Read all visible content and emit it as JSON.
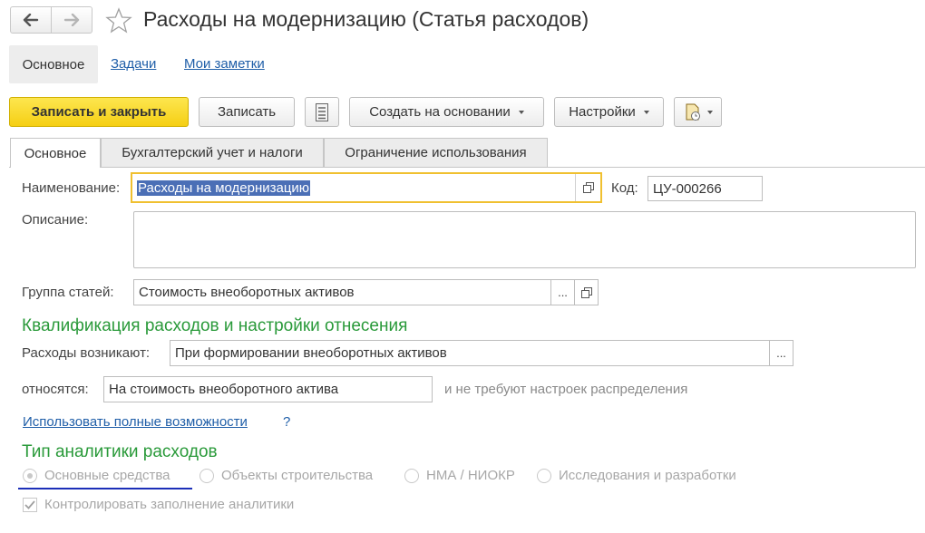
{
  "window": {
    "title": "Расходы на модернизацию (Статья расходов)"
  },
  "sections": {
    "active": "Основное",
    "links": [
      "Задачи",
      "Мои заметки"
    ]
  },
  "toolbar": {
    "save_close": "Записать и закрыть",
    "save": "Записать",
    "create_based_on": "Создать на основании",
    "settings": "Настройки"
  },
  "tabs": [
    "Основное",
    "Бухгалтерский учет и налоги",
    "Ограничение использования"
  ],
  "form": {
    "name_label": "Наименование:",
    "name_value": "Расходы на модернизацию",
    "code_label": "Код:",
    "code_value": "ЦУ-000266",
    "description_label": "Описание:",
    "description_value": "",
    "group_label": "Группа статей:",
    "group_value": "Стоимость внеоборотных активов",
    "select_button": "...",
    "qualification_heading": "Квалификация расходов и настройки отнесения",
    "arise_label": "Расходы возникают:",
    "arise_value": "При формировании внеоборотных активов",
    "relate_label": "относятся:",
    "relate_value": "На стоимость внеоборотного актива",
    "relate_hint": "и не требуют настроек распределения",
    "full_features_link": "Использовать полные возможности",
    "help_mark": "?",
    "analytics_heading": "Тип аналитики расходов",
    "analytics_options": [
      {
        "label": "Основные средства",
        "selected": true
      },
      {
        "label": "Объекты строительства",
        "selected": false
      },
      {
        "label": "НМА / НИОКР",
        "selected": false
      },
      {
        "label": "Исследования и разработки",
        "selected": false
      }
    ],
    "control_checkbox_label": "Контролировать заполнение аналитики",
    "control_checkbox_checked": true
  },
  "colors": {
    "primary_button": "#f5cf14",
    "heading_green": "#2a9a3a",
    "link_blue": "#1f5ea8",
    "focus_border": "#f0c030",
    "selection_bg": "#4b6fb6",
    "annotation_underline": "#1c2fb8"
  },
  "icons": [
    "back-arrow-icon",
    "forward-arrow-icon",
    "favorite-star-icon",
    "list-report-icon",
    "open-form-icon",
    "attachment-icon"
  ]
}
